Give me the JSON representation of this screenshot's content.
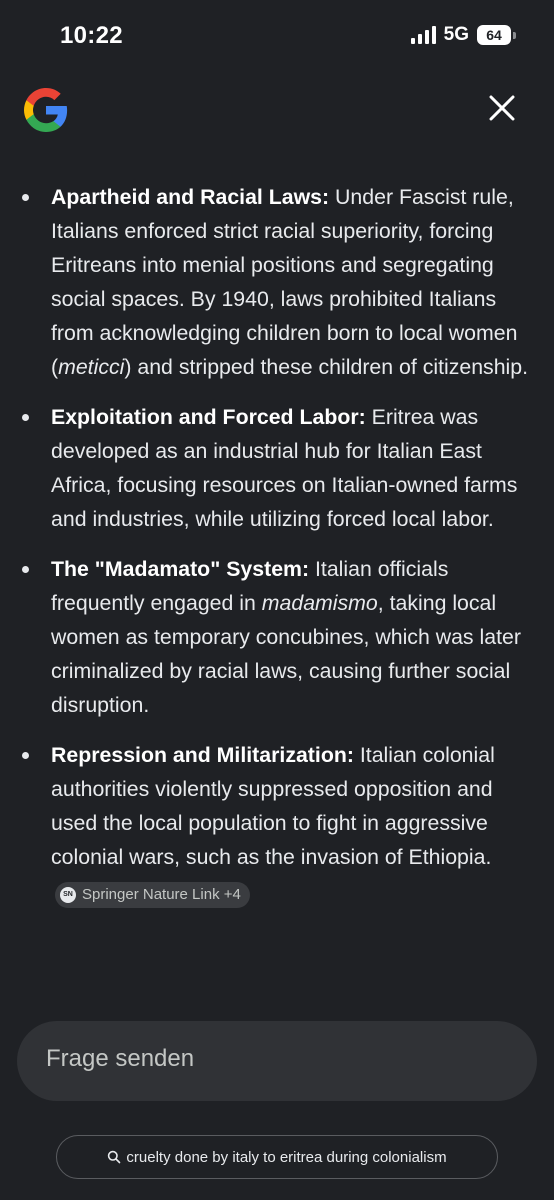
{
  "status_bar": {
    "time": "10:22",
    "network": "5G",
    "battery": "64"
  },
  "header": {
    "logo_icon": "google-g-icon",
    "close_icon": "close-icon"
  },
  "bullets": [
    {
      "title": "Apartheid and Racial Laws:",
      "text_1": " Under Fascist rule, Italians enforced strict racial superiority, forcing Eritreans into menial positions and segregating social spaces. By 1940, laws prohibited Italians from acknowledging children born to local women (",
      "italic": "meticci",
      "text_2": ") and stripped these children of citizenship."
    },
    {
      "title": "Exploitation and Forced Labor:",
      "text_1": " Eritrea was developed as an industrial hub for Italian East Africa, focusing resources on Italian-owned farms and industries, while utilizing forced local labor."
    },
    {
      "title": "The \"Madamato\" System:",
      "text_1": " Italian officials frequently engaged in ",
      "italic": "madamismo",
      "text_2": ", taking local women as temporary concubines, which was later criminalized by racial laws, causing further social disruption."
    },
    {
      "title": "Repression and Militarization:",
      "text_1": " Italian colonial authorities violently suppressed opposition and used the local population to fight in aggressive colonial wars, such as the invasion of Ethiopia."
    }
  ],
  "source_chip": {
    "icon_label": "SN",
    "label": "Springer Nature Link +4"
  },
  "ask": {
    "placeholder": "Frage senden"
  },
  "query_chip": {
    "icon": "search-icon",
    "text": "cruelty done by italy to eritrea during colonialism"
  }
}
